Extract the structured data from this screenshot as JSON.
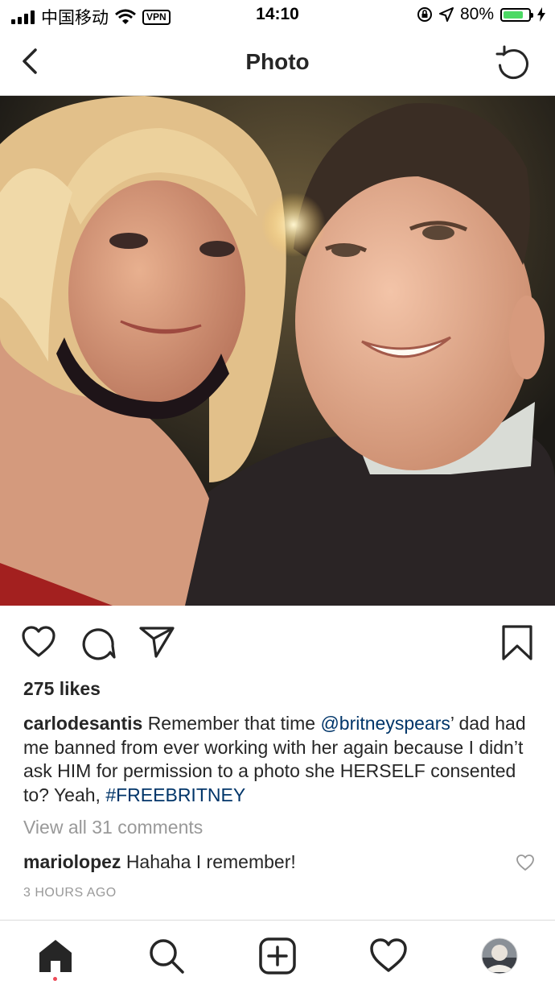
{
  "status_bar": {
    "carrier": "中国移动",
    "vpn": "VPN",
    "time": "14:10",
    "battery": "80%",
    "battery_level": 0.8
  },
  "header": {
    "title": "Photo"
  },
  "post": {
    "likes": "275 likes",
    "caption": {
      "username": "carlodesantis",
      "text_1": "Remember that time ",
      "mention": "@britneyspears",
      "text_2": "’ dad had me banned from ever working with her again because I didn’t ask HIM for permission to a photo she HERSELF consented to? Yeah, ",
      "hashtag": "#FREEBRITNEY"
    },
    "view_all_comments": "View all 31 comments",
    "comment": {
      "username": "mariolopez",
      "text": "Hahaha I remember!"
    },
    "time_ago": "3 HOURS AGO"
  },
  "tabs": [
    "home-icon",
    "search-icon",
    "add-post-icon",
    "activity-heart-icon",
    "profile-avatar"
  ]
}
